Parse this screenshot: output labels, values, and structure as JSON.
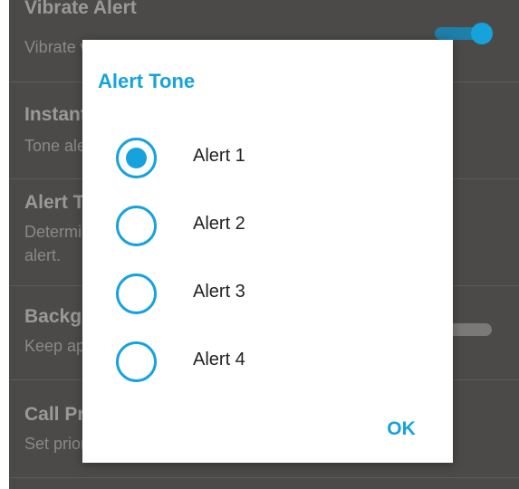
{
  "settings": {
    "items": [
      {
        "title": "Vibrate Alert",
        "summary": "Vibrate when an alert is received"
      },
      {
        "title": "Instant Alert",
        "summary": "Tone alert"
      },
      {
        "title": "Alert Tone",
        "summary": "Determine the tone of the",
        "summary2": "alert."
      },
      {
        "title": "Background",
        "summary": "Keep app"
      },
      {
        "title": "Call Priority",
        "summary": "Set priority"
      }
    ],
    "vibrate_switch_on": true,
    "background_switch_on": false
  },
  "dialog": {
    "title": "Alert Tone",
    "options": [
      {
        "label": "Alert 1",
        "selected": true
      },
      {
        "label": "Alert 2",
        "selected": false
      },
      {
        "label": "Alert 3",
        "selected": false
      },
      {
        "label": "Alert 4",
        "selected": false
      }
    ],
    "ok_label": "OK"
  },
  "colors": {
    "accent": "#16a3dc",
    "background": "#4b4a48"
  }
}
